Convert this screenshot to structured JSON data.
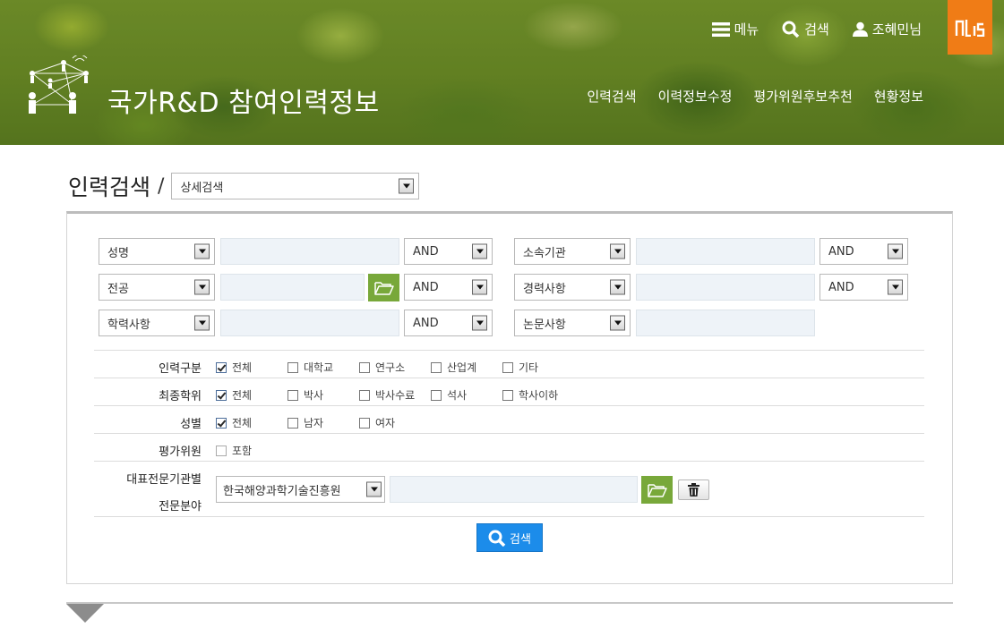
{
  "header": {
    "site_title": "국가R&D 참여인력정보",
    "util_nav": [
      {
        "label": "메뉴",
        "icon": "menu-icon"
      },
      {
        "label": "검색",
        "icon": "search-icon"
      },
      {
        "label": "조혜민님",
        "icon": "user-icon"
      }
    ],
    "ntis_logo_text": "ntis",
    "main_nav": [
      "인력검색",
      "이력정보수정",
      "평가위원후보추천",
      "현황정보"
    ]
  },
  "page": {
    "title": "인력검색",
    "separator": "/",
    "mode_select": "상세검색"
  },
  "fields": {
    "left": [
      {
        "select": "성명",
        "op": "AND",
        "has_folder": false
      },
      {
        "select": "전공",
        "op": "AND",
        "has_folder": true
      },
      {
        "select": "학력사항",
        "op": "AND",
        "has_folder": false
      }
    ],
    "right": [
      {
        "select": "소속기관",
        "op": "AND"
      },
      {
        "select": "경력사항",
        "op": "AND"
      },
      {
        "select": "논문사항",
        "op": ""
      }
    ]
  },
  "options": {
    "personnel_type": {
      "label": "인력구분",
      "items": [
        {
          "label": "전체",
          "checked": true
        },
        {
          "label": "대학교",
          "checked": false
        },
        {
          "label": "연구소",
          "checked": false
        },
        {
          "label": "산업계",
          "checked": false
        },
        {
          "label": "기타",
          "checked": false
        }
      ]
    },
    "degree": {
      "label": "최종학위",
      "items": [
        {
          "label": "전체",
          "checked": true
        },
        {
          "label": "박사",
          "checked": false
        },
        {
          "label": "박사수료",
          "checked": false
        },
        {
          "label": "석사",
          "checked": false
        },
        {
          "label": "학사이하",
          "checked": false
        }
      ]
    },
    "gender": {
      "label": "성별",
      "items": [
        {
          "label": "전체",
          "checked": true
        },
        {
          "label": "남자",
          "checked": false
        },
        {
          "label": "여자",
          "checked": false
        }
      ]
    },
    "evaluator": {
      "label": "평가위원",
      "items": [
        {
          "label": "포함",
          "checked": false
        }
      ]
    },
    "expert_field": {
      "label_line1": "대표전문기관별",
      "label_line2": "전문분야",
      "select": "한국해양과학기술진흥원"
    }
  },
  "search_button": "검색",
  "colors": {
    "accent_blue": "#1c8cea",
    "folder_green": "#78a83a",
    "ntis_orange": "#f07c16",
    "input_bg": "#eef3f8"
  }
}
